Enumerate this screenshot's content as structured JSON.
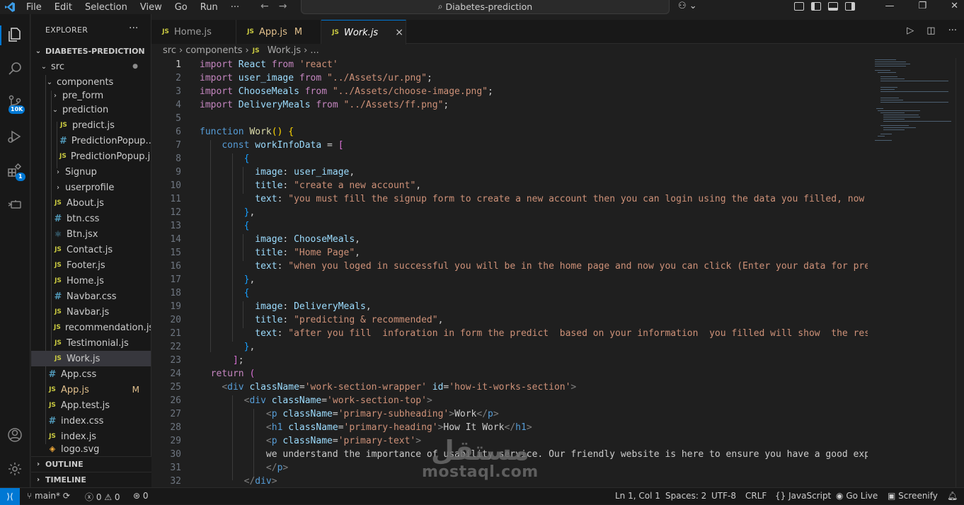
{
  "menu": [
    "File",
    "Edit",
    "Selection",
    "View",
    "Go",
    "Run",
    "···"
  ],
  "search": {
    "text": "Diabetes-prediction"
  },
  "explorer": {
    "title": "EXPLORER",
    "root": "DIABETES-PREDICTION",
    "items": [
      {
        "label": "src",
        "type": "folder"
      },
      {
        "label": "components",
        "type": "folder"
      },
      {
        "label": "pre_form",
        "type": "folder"
      },
      {
        "label": "prediction",
        "type": "folder"
      },
      {
        "label": "predict.js",
        "type": "js"
      },
      {
        "label": "PredictionPopup....",
        "type": "css"
      },
      {
        "label": "PredictionPopup.js",
        "type": "js"
      },
      {
        "label": "Signup",
        "type": "folder"
      },
      {
        "label": "userprofile",
        "type": "folder"
      },
      {
        "label": "About.js",
        "type": "js"
      },
      {
        "label": "btn.css",
        "type": "css"
      },
      {
        "label": "Btn.jsx",
        "type": "jsx"
      },
      {
        "label": "Contact.js",
        "type": "js"
      },
      {
        "label": "Footer.js",
        "type": "js"
      },
      {
        "label": "Home.js",
        "type": "js"
      },
      {
        "label": "Navbar.css",
        "type": "css"
      },
      {
        "label": "Navbar.js",
        "type": "js"
      },
      {
        "label": "recommendation.js",
        "type": "js"
      },
      {
        "label": "Testimonial.js",
        "type": "js"
      },
      {
        "label": "Work.js",
        "type": "js"
      },
      {
        "label": "App.css",
        "type": "css"
      },
      {
        "label": "App.js",
        "type": "js",
        "flag": "M"
      },
      {
        "label": "App.test.js",
        "type": "js"
      },
      {
        "label": "index.css",
        "type": "css"
      },
      {
        "label": "index.js",
        "type": "js"
      },
      {
        "label": "logo.svg",
        "type": "svg"
      }
    ],
    "outline": "OUTLINE",
    "timeline": "TIMELINE"
  },
  "tabs": [
    {
      "label": "Home.js",
      "flag": ""
    },
    {
      "label": "App.js",
      "flag": "M"
    },
    {
      "label": "Work.js",
      "flag": "×"
    }
  ],
  "breadcrumb": [
    "src",
    "components",
    "Work.js",
    "..."
  ],
  "badges": {
    "source_control": "10K",
    "extensions": "1"
  },
  "code_lines": [
    "1",
    "2",
    "3",
    "4",
    "5",
    "6",
    "7",
    "8",
    "9",
    "10",
    "11",
    "12",
    "13",
    "14",
    "15",
    "16",
    "17",
    "18",
    "19",
    "20",
    "21",
    "22",
    "23",
    "24",
    "25",
    "26",
    "27",
    "28",
    "29",
    "30",
    "31",
    "32"
  ],
  "code_strings": {
    "react": "'react'",
    "ur": "\"../Assets/ur.png\"",
    "choose": "\"../Assets/choose-image.png\"",
    "ff": "\"../Assets/ff.png\"",
    "title1": "\"create a new account\"",
    "text1": "\"you must fill the signup form to create a new account then you can login using the data you filled, now yo",
    "title2": "\"Home Page\"",
    "text2": "\"when you loged in successful you will be in the home page and now you can click (Enter your data for predi",
    "title3": "\"predicting & recommended\"",
    "text3": "\"after you fill  inforation in form the predict  based on your information  you filled will show  the resul",
    "wrapper": "'work-section-wrapper'",
    "wid": "'how-it-works-section'",
    "top": "'work-section-top'",
    "subh": "'primary-subheading'",
    "work": "Work",
    "head": "'primary-heading'",
    "hiw": "How It Work",
    "ptext": "'primary-text'",
    "para": "we understand the importance of usability service. Our friendly website is here to ensure you have a good exper"
  },
  "status": {
    "branch": "main*",
    "problems": "0",
    "warnings": "0",
    "ports": "0",
    "position": "Ln 1, Col 1",
    "spaces": "Spaces: 2",
    "encoding": "UTF-8",
    "eol": "CRLF",
    "language": "JavaScript",
    "golive": "Go Live",
    "screenify": "Screenify"
  },
  "watermark": {
    "arabic": "مستقل",
    "latin": "mostaql.com"
  }
}
